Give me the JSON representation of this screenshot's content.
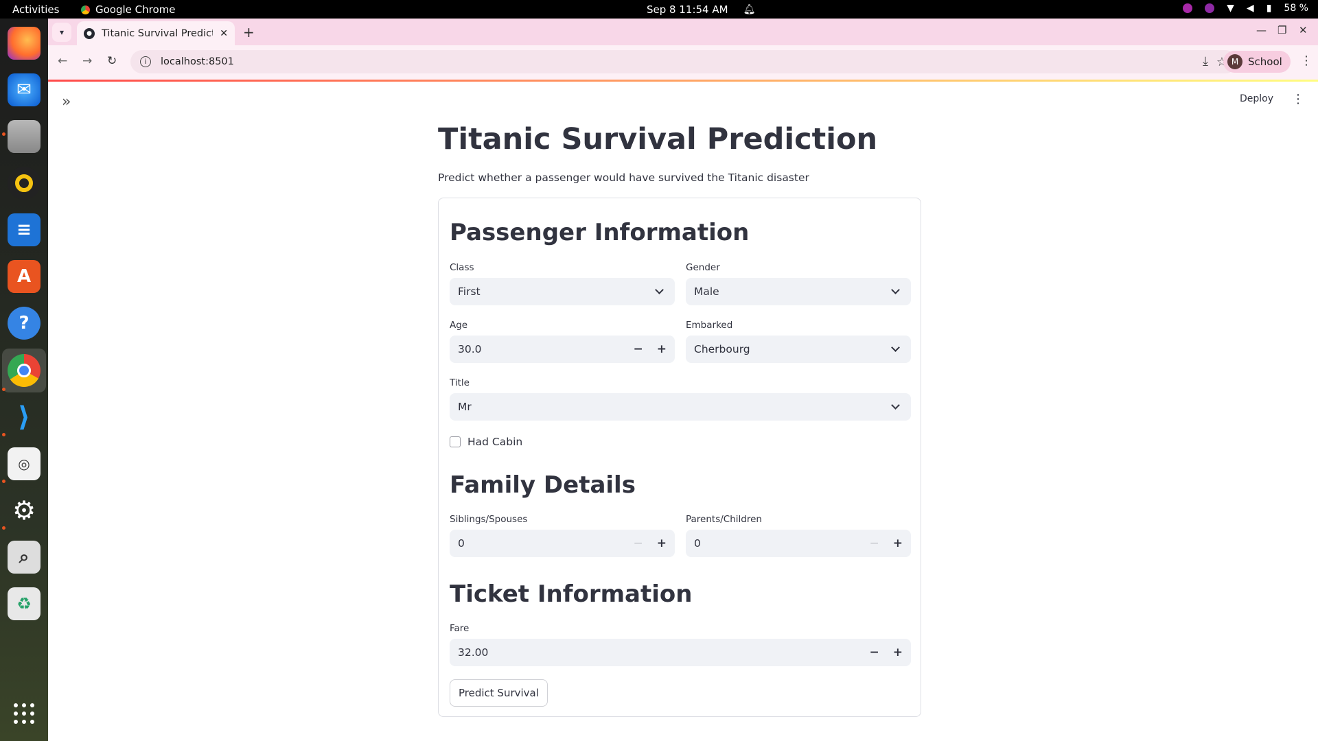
{
  "system": {
    "activities": "Activities",
    "app_name": "Google Chrome",
    "clock": "Sep 8  11:54 AM",
    "battery": "58 %"
  },
  "browser": {
    "tab_title": "Titanic Survival Predictor",
    "url": "localhost:8501",
    "profile_initial": "M",
    "profile_name": "School"
  },
  "app_header": {
    "deploy_label": "Deploy"
  },
  "page": {
    "title": "Titanic Survival Prediction",
    "subtitle": "Predict whether a passenger would have survived the Titanic disaster"
  },
  "passenger": {
    "heading": "Passenger Information",
    "class_label": "Class",
    "class_value": "First",
    "gender_label": "Gender",
    "gender_value": "Male",
    "age_label": "Age",
    "age_value": "30.0",
    "embarked_label": "Embarked",
    "embarked_value": "Cherbourg",
    "title_label": "Title",
    "title_value": "Mr",
    "cabin_label": "Had Cabin",
    "cabin_checked": false
  },
  "family": {
    "heading": "Family Details",
    "siblings_label": "Siblings/Spouses",
    "siblings_value": "0",
    "parents_label": "Parents/Children",
    "parents_value": "0"
  },
  "ticket": {
    "heading": "Ticket Information",
    "fare_label": "Fare",
    "fare_value": "32.00"
  },
  "actions": {
    "predict_label": "Predict Survival"
  },
  "icons": {
    "minus": "−",
    "plus": "+"
  }
}
